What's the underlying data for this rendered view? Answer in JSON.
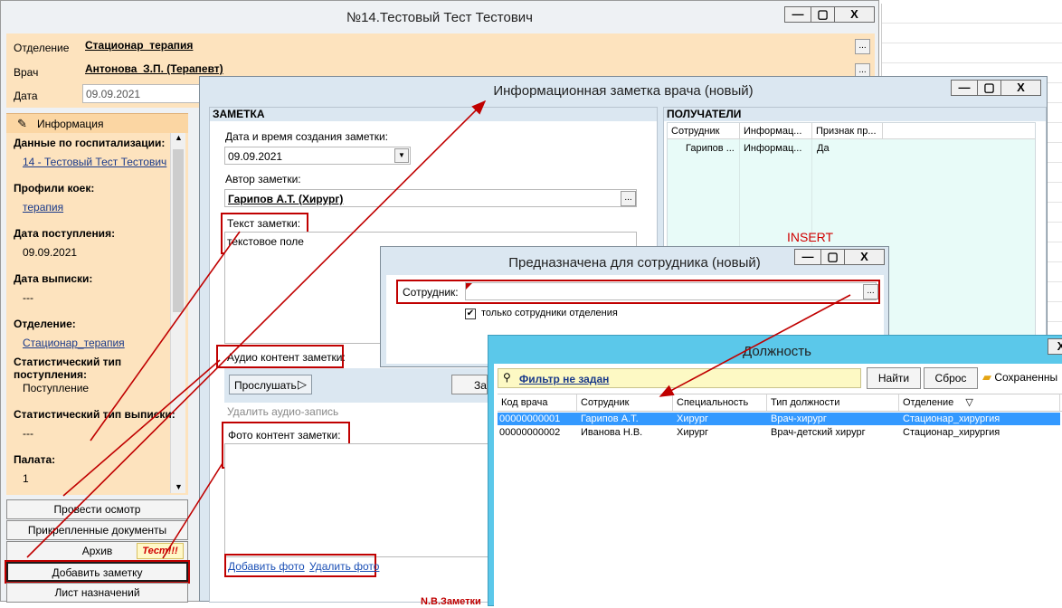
{
  "main_window": {
    "title": "№14.Тестовый Тест Тестович",
    "controls": [
      "—",
      "▢",
      "X"
    ],
    "fields": {
      "department_label": "Отделение",
      "department_value": "Стационар_терапия",
      "doctor_label": "Врач",
      "doctor_value": "Антонова_З.П. (Терапевт)",
      "date_label": "Дата",
      "date_value": "09.09.2021"
    },
    "info_tab": "Информация",
    "info": [
      {
        "label": "Данные по госпитализации:",
        "value": "14 - Тестовый Тест Тестович",
        "link": true
      },
      {
        "label": "Профили коек:",
        "value": "терапия",
        "link": true
      },
      {
        "label": "Дата поступления:",
        "value": "09.09.2021",
        "link": false
      },
      {
        "label": "Дата выписки:",
        "value": "---",
        "link": false
      },
      {
        "label": "Отделение:",
        "value": "Стационар_терапия",
        "link": true
      },
      {
        "label": "Статистический тип поступления:",
        "value": "Поступление",
        "link": false
      },
      {
        "label": "Статистический тип выписки:",
        "value": "---",
        "link": false
      },
      {
        "label": "Палата:",
        "value": "1",
        "link": false
      }
    ],
    "buttons": {
      "exam": "Провести осмотр",
      "docs": "Прикрепленные документы",
      "archive": "Архив",
      "test_badge": "Тест!!!",
      "add_note": "Добавить заметку",
      "prescriptions": "Лист назначений"
    }
  },
  "note_window": {
    "title": "Информационная заметка врача (новый)",
    "controls": [
      "—",
      "▢",
      "X"
    ],
    "section_note": "ЗАМЕТКА",
    "section_recipients": "ПОЛУЧАТЕЛИ",
    "date_label": "Дата и время создания заметки:",
    "date_value": "09.09.2021",
    "author_label": "Автор заметки:",
    "author_value": "Гарипов А.Т. (Хирург)",
    "text_label": "Текст заметки:",
    "text_value": "текстовое поле",
    "audio_label": "Аудио контент заметки:",
    "listen_button": "Прослушать",
    "partial_button": "За",
    "delete_audio": "Удалить аудио-запись",
    "photo_label": "Фото контент заметки:",
    "add_photo": "Добавить фото",
    "delete_photo": "Удалить фото",
    "bottom_fragment": "N.B.Заметки",
    "recipients_headers": [
      "Сотрудник",
      "Информац...",
      "Признак пр..."
    ],
    "recipients_rows": [
      [
        "Гарипов ...",
        "Информац...",
        "Да"
      ]
    ],
    "insert_label": "INSERT"
  },
  "employee_window": {
    "title": "Предназначена для сотрудника (новый)",
    "controls": [
      "—",
      "▢",
      "X"
    ],
    "employee_label": "Сотрудник:",
    "employee_value": "",
    "checkbox_label": "только сотрудники отделения",
    "checkbox_checked": true
  },
  "position_window": {
    "title": "Должность",
    "filter_text": "Фильтр не задан",
    "find_button": "Найти",
    "reset_button": "Сброс",
    "saved_button": "Сохраненны",
    "headers": [
      "Код врача",
      "Сотрудник",
      "Специальность",
      "Тип должности",
      "Отделение"
    ],
    "rows": [
      [
        "00000000001",
        "Гарипов А.Т.",
        "Хирург",
        "Врач-хирург",
        "Стационар_хирургия"
      ],
      [
        "00000000002",
        "Иванова Н.В.",
        "Хирург",
        "Врач-детский хирург",
        "Стационар_хирургия"
      ]
    ]
  },
  "colors": {
    "annotation_red": "#c00000",
    "sidebar_bg": "#fde3be",
    "dialog_header": "#dbe7f1",
    "position_header": "#5bc8ea",
    "selection_blue": "#3399ff",
    "recipients_bg": "#e8fbf8"
  }
}
